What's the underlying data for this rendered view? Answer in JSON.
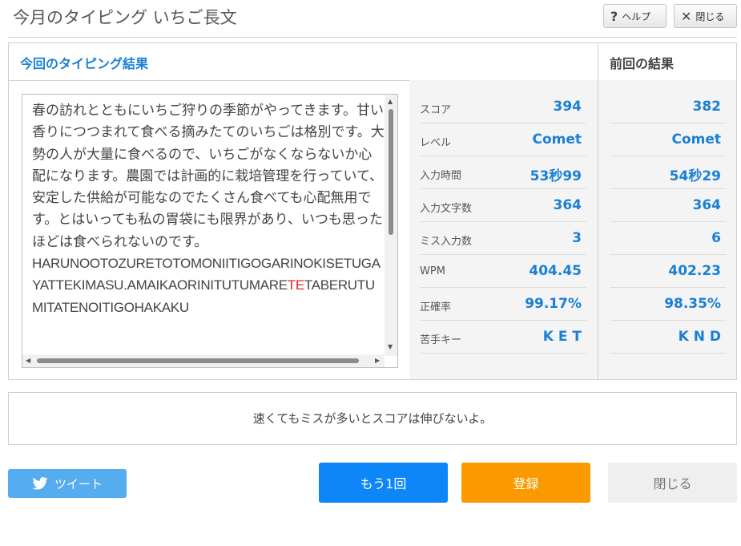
{
  "header": {
    "title": "今月のタイピング いちご長文",
    "help_label": "ヘルプ",
    "close_label": "閉じる"
  },
  "panel": {
    "current_title": "今回のタイピング結果",
    "previous_title": "前回の結果"
  },
  "text": {
    "japanese": "春の訪れとともにいちご狩りの季節がやってきます。甘い香りにつつまれて食べる摘みたてのいちごは格別です。大勢の人が大量に食べるので、いちごがなくならないか心配になります。農園では計画的に栽培管理を行っていて、安定した供給が可能なのでたくさん食べても心配無用です。とはいっても私の胃袋にも限界があり、いつも思ったほどは食べられないのです。",
    "romaji_before": "HARUNOOTOZURETOTOMONIITIGOGARINOKISETUGAYATTEKIMASU.AMAIKAORINITUTUMARE",
    "romaji_miss": "TE",
    "romaji_after": "TABERUTUMITATENOITIGOHAKAKU"
  },
  "stats": {
    "labels": [
      "スコア",
      "レベル",
      "入力時間",
      "入力文字数",
      "ミス入力数",
      "WPM",
      "正確率",
      "苦手キー"
    ],
    "current": [
      "394",
      "Comet",
      "53秒99",
      "364",
      "3",
      "404.45",
      "99.17%",
      "K E T"
    ],
    "previous": [
      "382",
      "Comet",
      "54秒29",
      "364",
      "6",
      "402.23",
      "98.35%",
      "K N D"
    ]
  },
  "advice": "速くてもミスが多いとスコアは伸びないよ。",
  "buttons": {
    "tweet": "ツイート",
    "retry": "もう1回",
    "register": "登録",
    "close": "閉じる"
  },
  "colors": {
    "accent_blue": "#1a7fd6",
    "retry_blue": "#0d86f7",
    "register_orange": "#fa9a00",
    "twitter_blue": "#55acee",
    "miss_red": "#e02020"
  },
  "icons": {
    "help": "question-mark-icon",
    "close": "x-icon",
    "tweet": "twitter-bird-icon"
  }
}
